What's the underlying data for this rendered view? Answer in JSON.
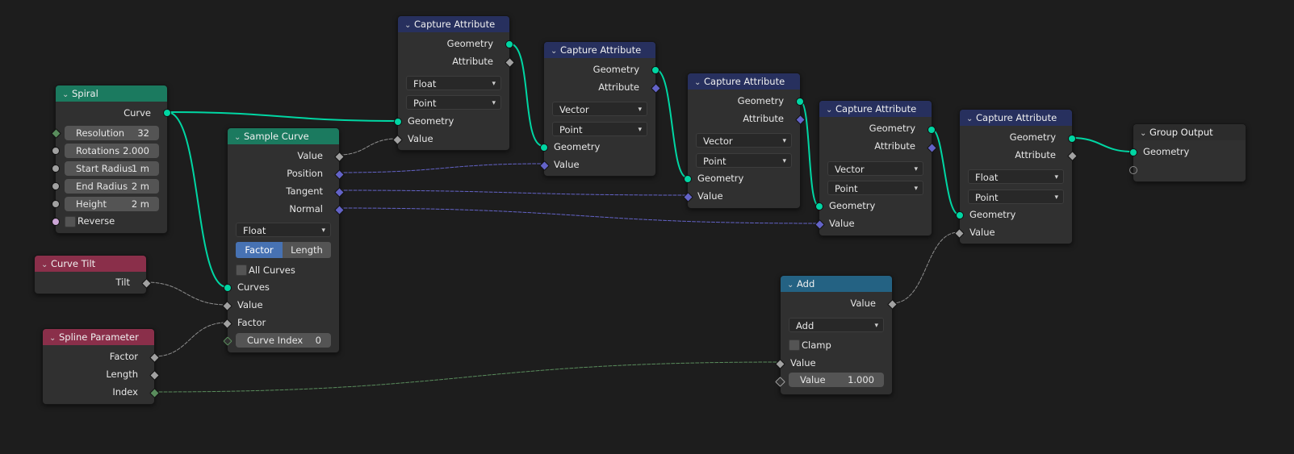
{
  "colors": {
    "geometry_socket": "#00d6a3",
    "float_socket": "#a1a1a1",
    "vector_socket": "#6363c7",
    "integer_socket": "#598c5c",
    "boolean_socket": "#cca6d6",
    "geometry_header": "#1b7a5f",
    "attribute_header": "#27305e",
    "input_header": "#8a2f4a",
    "math_header": "#246283",
    "selected_toggle": "#4772b3"
  },
  "spiral": {
    "title": "Spiral",
    "out_curve": "Curve",
    "resolution_label": "Resolution",
    "resolution_value": "32",
    "rotations_label": "Rotations",
    "rotations_value": "2.000",
    "start_radius_label": "Start Radius",
    "start_radius_value": "1 m",
    "end_radius_label": "End Radius",
    "end_radius_value": "2 m",
    "height_label": "Height",
    "height_value": "2 m",
    "reverse_label": "Reverse"
  },
  "curve_tilt": {
    "title": "Curve Tilt",
    "out_tilt": "Tilt"
  },
  "spline_parameter": {
    "title": "Spline Parameter",
    "out_factor": "Factor",
    "out_length": "Length",
    "out_index": "Index"
  },
  "sample_curve": {
    "title": "Sample Curve",
    "out_value": "Value",
    "out_position": "Position",
    "out_tangent": "Tangent",
    "out_normal": "Normal",
    "data_type": "Float",
    "mode_factor": "Factor",
    "mode_length": "Length",
    "all_curves": "All Curves",
    "in_curves": "Curves",
    "in_value": "Value",
    "in_factor": "Factor",
    "curve_index_label": "Curve Index",
    "curve_index_value": "0"
  },
  "capture_nodes": [
    {
      "title": "Capture Attribute",
      "out_geometry": "Geometry",
      "out_attribute": "Attribute",
      "data_type": "Float",
      "domain": "Point",
      "in_geometry": "Geometry",
      "in_value": "Value"
    },
    {
      "title": "Capture Attribute",
      "out_geometry": "Geometry",
      "out_attribute": "Attribute",
      "data_type": "Vector",
      "domain": "Point",
      "in_geometry": "Geometry",
      "in_value": "Value"
    },
    {
      "title": "Capture Attribute",
      "out_geometry": "Geometry",
      "out_attribute": "Attribute",
      "data_type": "Vector",
      "domain": "Point",
      "in_geometry": "Geometry",
      "in_value": "Value"
    },
    {
      "title": "Capture Attribute",
      "out_geometry": "Geometry",
      "out_attribute": "Attribute",
      "data_type": "Vector",
      "domain": "Point",
      "in_geometry": "Geometry",
      "in_value": "Value"
    },
    {
      "title": "Capture Attribute",
      "out_geometry": "Geometry",
      "out_attribute": "Attribute",
      "data_type": "Float",
      "domain": "Point",
      "in_geometry": "Geometry",
      "in_value": "Value"
    }
  ],
  "add": {
    "title": "Add",
    "out_value": "Value",
    "operation": "Add",
    "clamp": "Clamp",
    "in_value": "Value",
    "value_label": "Value",
    "value_value": "1.000"
  },
  "group_output": {
    "title": "Group Output",
    "in_geometry": "Geometry"
  }
}
